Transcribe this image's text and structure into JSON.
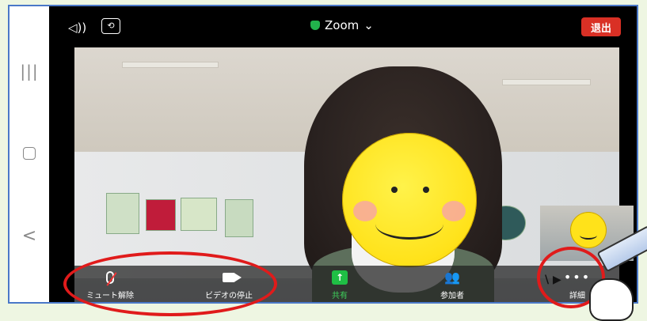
{
  "topbar": {
    "speaker_icon": "speaker-icon",
    "camera_switch_icon": "camera-switch-icon",
    "meeting_title": "Zoom",
    "leave_label": "退出"
  },
  "nav": {
    "recent_glyph": "|||",
    "back_glyph": "<"
  },
  "toolbar": {
    "mute_label": "ミュート解除",
    "video_label": "ビデオの停止",
    "share_label": "共有",
    "participants_label": "参加者",
    "more_label": "詳細"
  },
  "colors": {
    "leave": "#d93025",
    "share": "#1fbf45",
    "highlight": "#e01b1b",
    "frame": "#4a78c8"
  }
}
